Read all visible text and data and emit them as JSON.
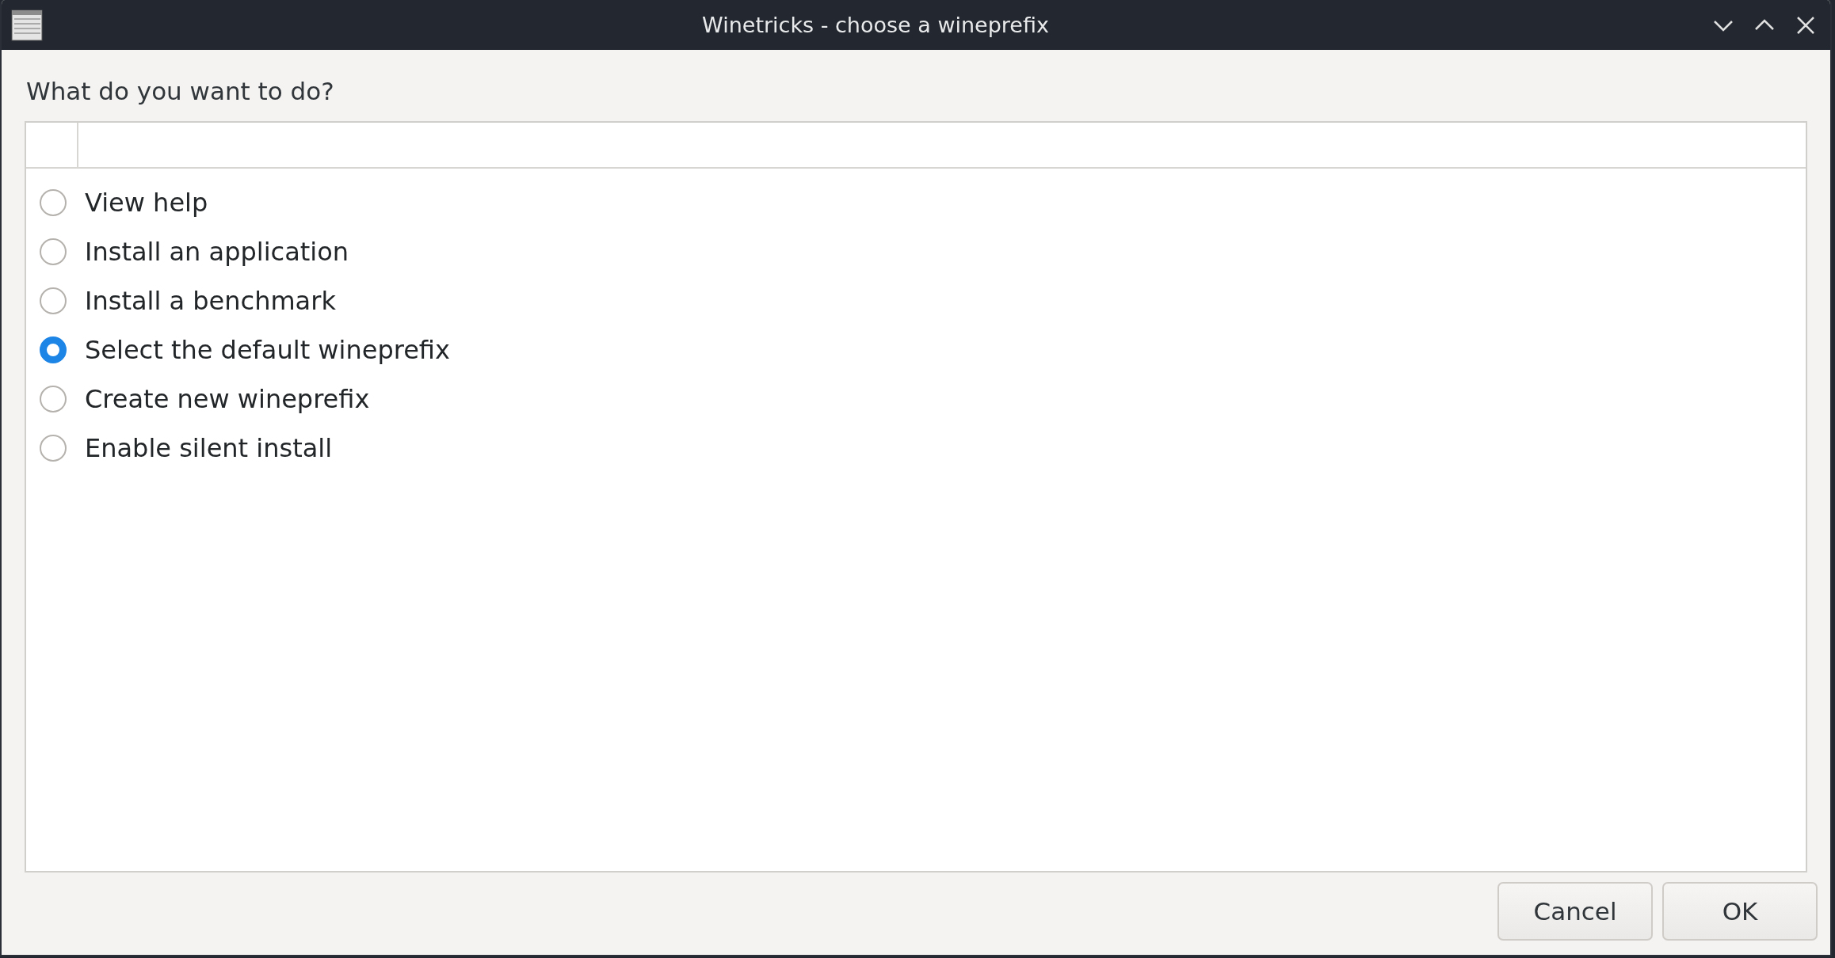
{
  "window": {
    "title": "Winetricks - choose a wineprefix"
  },
  "prompt": "What do you want to do?",
  "options": [
    {
      "label": "View help",
      "selected": false
    },
    {
      "label": "Install an application",
      "selected": false
    },
    {
      "label": "Install a benchmark",
      "selected": false
    },
    {
      "label": "Select the default wineprefix",
      "selected": true
    },
    {
      "label": "Create new wineprefix",
      "selected": false
    },
    {
      "label": "Enable silent install",
      "selected": false
    }
  ],
  "buttons": [
    "Cancel",
    "OK"
  ]
}
